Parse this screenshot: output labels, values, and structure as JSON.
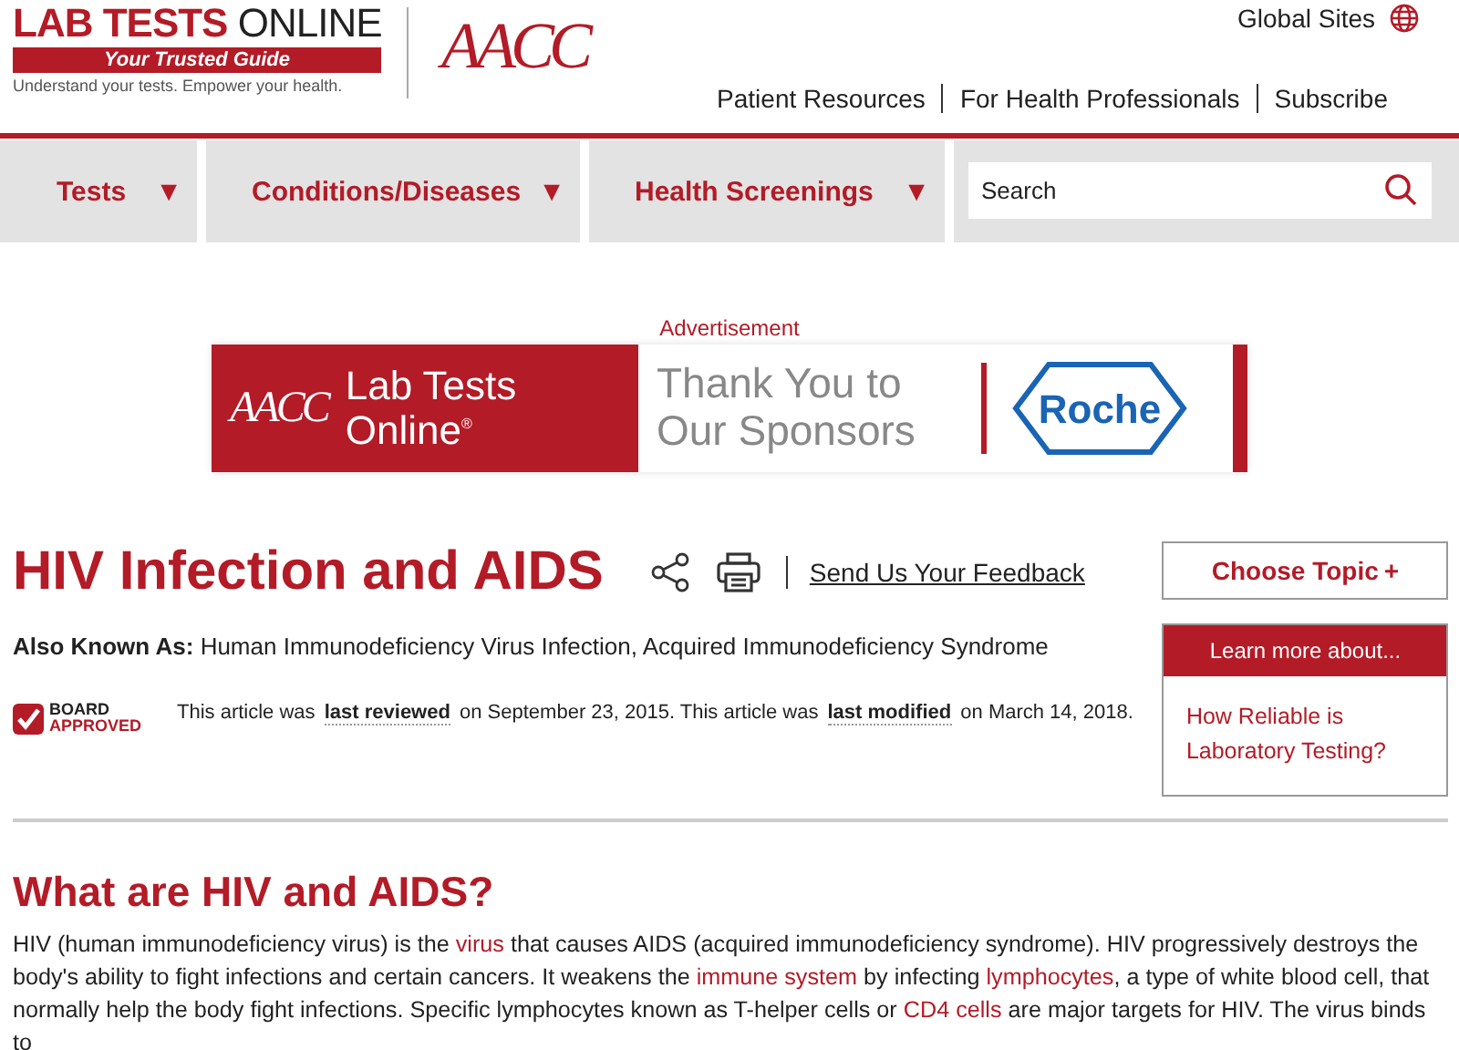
{
  "logo": {
    "title_bold": "LAB TESTS",
    "title_light": "ONLINE",
    "ribbon": "Your Trusted Guide",
    "tagline": "Understand your tests. Empower your health.",
    "partner": "AACC"
  },
  "global_sites": "Global Sites",
  "top_links": [
    "Patient Resources",
    "For Health Professionals",
    "Subscribe"
  ],
  "nav": [
    {
      "label": "Tests",
      "caret": "▼"
    },
    {
      "label": "Conditions/Diseases",
      "caret": "▼"
    },
    {
      "label": "Health Screenings",
      "caret": "▼"
    }
  ],
  "search": {
    "placeholder": "Search"
  },
  "ad": {
    "label": "Advertisement",
    "brand_small": "AACC",
    "brand_line1": "Lab Tests",
    "brand_line2": "Online",
    "registered": "®",
    "thanks_line1": "Thank You to",
    "thanks_line2": "Our Sponsors",
    "sponsor": "Roche"
  },
  "article": {
    "title": "HIV Infection and AIDS",
    "feedback": "Send Us Your Feedback",
    "also_known_as_label": "Also Known As:",
    "also_known_as": "Human Immunodeficiency Virus Infection, Acquired Immunodeficiency Syndrome",
    "badge_line1": "BOARD",
    "badge_line2": "APPROVED",
    "review": [
      {
        "text": "This article was "
      },
      {
        "text": "last reviewed",
        "kind": "term"
      },
      {
        "text": " on September 23, 2015. This article was "
      },
      {
        "text": "last modified",
        "kind": "term"
      },
      {
        "text": " on March 14, 2018."
      }
    ],
    "heading": "What are HIV and AIDS?",
    "paragraph": [
      {
        "text": "HIV (human immunodeficiency virus) is the "
      },
      {
        "text": "virus",
        "kind": "link"
      },
      {
        "text": " that causes AIDS (acquired immunodeficiency syndrome). HIV progressively destroys the body's ability to fight infections and certain cancers. It weakens the "
      },
      {
        "text": "immune system",
        "kind": "link"
      },
      {
        "text": " by infecting "
      },
      {
        "text": "lymphocytes",
        "kind": "link"
      },
      {
        "text": ", a type of white blood cell, that normally help the body fight infections. Specific lymphocytes known as T-helper cells or "
      },
      {
        "text": "CD4 cells",
        "kind": "link"
      },
      {
        "text": " are major targets for HIV. The virus binds to"
      }
    ]
  },
  "sidebar": {
    "choose_topic": "Choose Topic",
    "choose_plus": "+",
    "learn_more": "Learn more about...",
    "links": [
      "How Reliable is Laboratory Testing?"
    ]
  }
}
